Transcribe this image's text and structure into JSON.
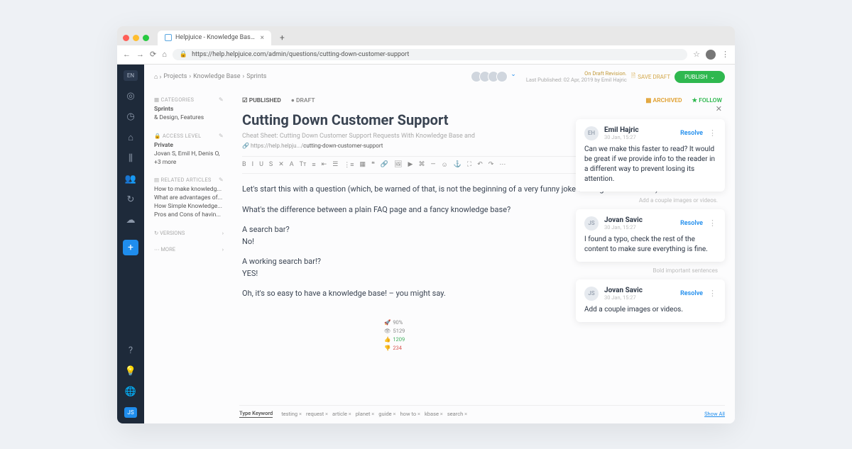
{
  "browser": {
    "tab_title": "Helpjuice - Knowledge Base S...",
    "url": "https://help.helpjuice.com/admin/questions/cutting-down-customer-support"
  },
  "sidebar": {
    "lang": "EN",
    "user_badge": "JS"
  },
  "breadcrumb": [
    "Projects",
    "Knowledge Base",
    "Sprints"
  ],
  "revision": {
    "status": "On Draft Revision.",
    "last_published": "Last Published: 02 Apr, 2019 by Emil Hajric"
  },
  "actions": {
    "save_draft": "SAVE DRAFT",
    "publish": "PUBLISH"
  },
  "meta": {
    "categories": {
      "label": "CATEGORIES",
      "line1": "Sprints",
      "line2": "& Design, Features"
    },
    "access": {
      "label": "ACCESS LEVEL",
      "line1": "Private",
      "line2": "Jovan S, Emil H, Denis O, +3 more"
    },
    "related": {
      "label": "RELATED ARTICLES",
      "items": [
        "How to make knowledg...",
        "What are advantages of...",
        "How Simple Knowledge...",
        "Pros and Cons of havin..."
      ]
    },
    "versions": "VERSIONS",
    "more": "MORE"
  },
  "stats": {
    "speed": "90%",
    "views": "5129",
    "upvotes": "1209",
    "downvotes": "234"
  },
  "editor": {
    "published_label": "PUBLISHED",
    "draft_label": "DRAFT",
    "archived_label": "ARCHIVED",
    "follow_label": "FOLLOW",
    "title": "Cutting Down Customer Support",
    "subtitle": "Cheat Sheet: Cutting Down Customer Support Requests With Knowledge Base and",
    "url_prefix": "https://help.helpju.../",
    "url_slug": "cutting-down-customer-support",
    "body": {
      "p1": "Let's start this with a question (which, be warned of that, is not the beginning of a very funny joke although it tends to be):",
      "p2": "What's the difference between a plain FAQ page and a fancy knowledge base?",
      "p3a": "A search bar?",
      "p3b": "No!",
      "p4a": "A working search bar!?",
      "p4b": "YES!",
      "p5": "Oh, it's so easy to have a knowledge base! – you might say."
    }
  },
  "tags": {
    "label": "Type Keyword",
    "items": [
      "testing",
      "request",
      "article",
      "planet",
      "guide",
      "how to",
      "kbase",
      "search"
    ],
    "show_all": "Show All"
  },
  "comments": {
    "ghost1": "Add a couple images or videos.",
    "ghost2": "Bold important sentences",
    "items": [
      {
        "initials": "EH",
        "name": "Emil Hajric",
        "date": "30 Jan, 15:27",
        "resolve": "Resolve",
        "body": "Can we make this faster to read? It would be great if we provide info to the reader in a different way to prevent losing its attention."
      },
      {
        "initials": "JS",
        "name": "Jovan Savic",
        "date": "30 Jan, 15:27",
        "resolve": "Resolve",
        "body": "I found a typo, check the rest of the content to make sure everything is fine."
      },
      {
        "initials": "JS",
        "name": "Jovan Savic",
        "date": "30 Jan, 15:27",
        "resolve": "Resolve",
        "body": "Add a couple images or videos."
      }
    ]
  }
}
